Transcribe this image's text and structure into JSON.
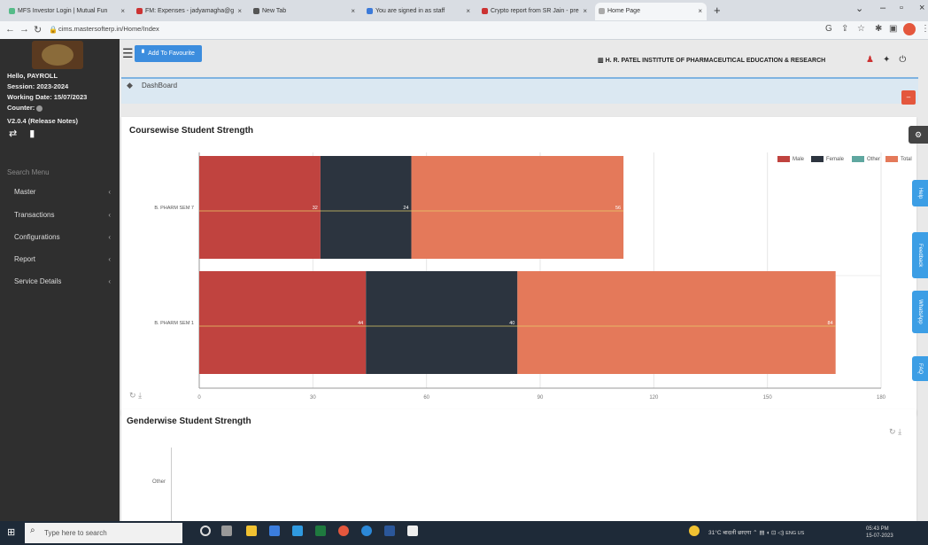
{
  "browser": {
    "tabs": [
      {
        "label": "MFS Investor Login | Mutual Fun"
      },
      {
        "label": "FM: Expenses - jadyamagha@g"
      },
      {
        "label": "New Tab"
      },
      {
        "label": "You are signed in as staff"
      },
      {
        "label": "Crypto report from SR Jain - pre"
      },
      {
        "label": "Home Page"
      }
    ],
    "url": "cims.mastersofterp.in/Home/Index"
  },
  "sidebar": {
    "user": "Hello, PAYROLL",
    "session": "Session: 2023-2024",
    "working_date": "Working Date: 15/07/2023",
    "counter": "Counter:",
    "version": "V2.0.4 (Release Notes)",
    "search_placeholder": "Search Menu",
    "menu": [
      {
        "label": "Master"
      },
      {
        "label": "Transactions"
      },
      {
        "label": "Configurations"
      },
      {
        "label": "Report"
      },
      {
        "label": "Service Details"
      }
    ]
  },
  "header": {
    "add_favourite": "Add To Favourite",
    "institute": "H. R. PATEL INSTITUTE OF PHARMACEUTICAL EDUCATION & RESEARCH"
  },
  "breadcrumb": {
    "label": "DashBoard"
  },
  "side_tabs": [
    "Help",
    "Feedback",
    "WhatsApp",
    "FAQ"
  ],
  "panels": {
    "coursewise_title": "Coursewise Student Strength",
    "genderwise_title": "Genderwise Student Strength",
    "gender_other_label": "Other"
  },
  "chart_data": {
    "type": "bar",
    "orientation": "horizontal",
    "stacked": true,
    "title": "Coursewise Student Strength",
    "categories": [
      "B. PHARM SEM 7",
      "B. PHARM SEM 1"
    ],
    "series": [
      {
        "name": "Male",
        "values": [
          32,
          44
        ],
        "color": "#c0433f"
      },
      {
        "name": "Female",
        "values": [
          24,
          40
        ],
        "color": "#2c343f"
      },
      {
        "name": "Other",
        "values": [
          0,
          0
        ],
        "color": "#5fa7a0"
      },
      {
        "name": "Total",
        "values": [
          56,
          84
        ],
        "color": "#e4795a"
      }
    ],
    "xlim": [
      0,
      180
    ],
    "xticks": [
      0,
      30,
      60,
      90,
      120,
      150,
      180
    ],
    "grid": true,
    "legend_position": "top-right"
  },
  "taskbar": {
    "search_placeholder": "Type here to search",
    "weather": "31°C बादली छाएगा",
    "lang": "ENG\nUS",
    "time": "05:43 PM",
    "date": "15-07-2023"
  }
}
